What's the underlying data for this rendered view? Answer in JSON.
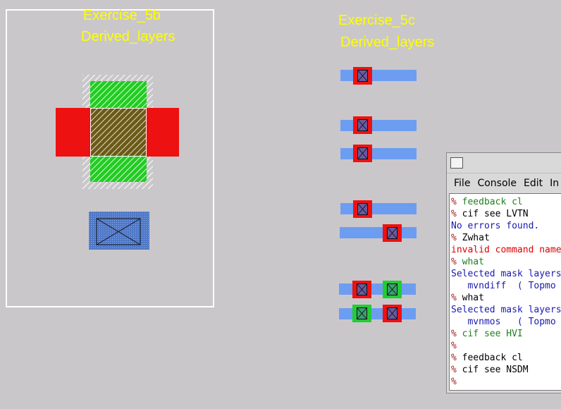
{
  "canvas": {
    "exercise_5b": {
      "title": "Exercise_5b",
      "subtitle": "Derived_layers"
    },
    "exercise_5c": {
      "title": "Exercise_5c",
      "subtitle": "Derived_layers"
    }
  },
  "colors": {
    "background": "#cac7cb",
    "label": "#ffff00",
    "diffusion": "#6d9df0",
    "poly": "#ee1111",
    "well": "#22cc33"
  },
  "console": {
    "icon": "window-icon",
    "menu": [
      "File",
      "Console",
      "Edit",
      "In"
    ],
    "lines": [
      {
        "prompt": "% ",
        "text": "feedback cl",
        "style": "green"
      },
      {
        "prompt": "% ",
        "text": "cif see LVTN",
        "style": "black"
      },
      {
        "prompt": "",
        "text": "No errors found.",
        "style": "blue"
      },
      {
        "prompt": "% ",
        "text": "Zwhat",
        "style": "black"
      },
      {
        "prompt": "",
        "text": "invalid command name",
        "style": "red"
      },
      {
        "prompt": "% ",
        "text": "what",
        "style": "green"
      },
      {
        "prompt": "",
        "text": "Selected mask layers",
        "style": "blue"
      },
      {
        "prompt": "",
        "text": "   mvndiff  ( Topmo",
        "style": "blue"
      },
      {
        "prompt": "% ",
        "text": "what",
        "style": "black"
      },
      {
        "prompt": "",
        "text": "Selected mask layers",
        "style": "blue"
      },
      {
        "prompt": "",
        "text": "   mvnmos   ( Topmo",
        "style": "blue"
      },
      {
        "prompt": "% ",
        "text": "cif see HVI",
        "style": "green"
      },
      {
        "prompt": "%",
        "text": "",
        "style": "black"
      },
      {
        "prompt": "% ",
        "text": "feedback cl",
        "style": "black"
      },
      {
        "prompt": "% ",
        "text": "cif see NSDM",
        "style": "black"
      },
      {
        "prompt": "%",
        "text": "",
        "style": "black"
      }
    ]
  }
}
